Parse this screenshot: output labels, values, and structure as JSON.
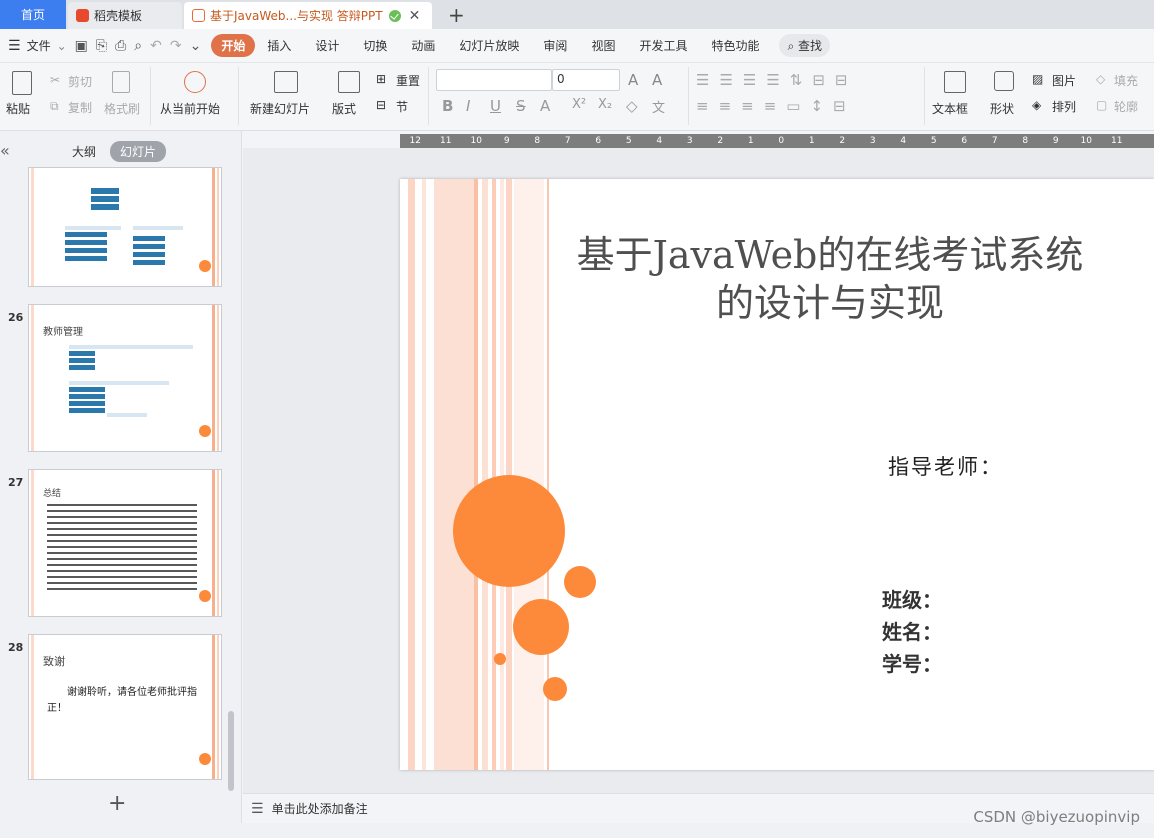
{
  "tabs": {
    "home": "首页",
    "tab1": "稻壳模板",
    "tab2": "基于JavaWeb...与实现 答辩PPT",
    "add": "+"
  },
  "ribbon": {
    "file": "文件",
    "items": [
      "开始",
      "插入",
      "设计",
      "切换",
      "动画",
      "幻灯片放映",
      "审阅",
      "视图",
      "开发工具",
      "特色功能"
    ],
    "search": "查找"
  },
  "toolbar": {
    "paste": "粘贴",
    "cut": "剪切",
    "copy": "复制",
    "format_painter": "格式刷",
    "from_current": "从当前开始",
    "new_slide": "新建幻灯片",
    "layout": "版式",
    "reset": "重置",
    "section": "节",
    "font_size": "0",
    "textbox": "文本框",
    "shape": "形状",
    "picture": "图片",
    "arrange": "排列",
    "fill": "填充",
    "outline": "轮廓"
  },
  "panel": {
    "collapse": "«",
    "outline_tab": "大纲",
    "slides_tab": "幻灯片",
    "thumbs": [
      {
        "num": "",
        "title": ""
      },
      {
        "num": "26",
        "title": "教师管理"
      },
      {
        "num": "27",
        "title": "总结"
      },
      {
        "num": "28",
        "title": "致谢",
        "body": "谢谢聆听，请各位老师批评指正！"
      }
    ],
    "add": "+"
  },
  "ruler": [
    "12",
    "11",
    "10",
    "9",
    "8",
    "7",
    "6",
    "5",
    "4",
    "3",
    "2",
    "1",
    "0",
    "1",
    "2",
    "3",
    "4",
    "5",
    "6",
    "7",
    "8",
    "9",
    "10",
    "11"
  ],
  "slide": {
    "title_line1": "基于JavaWeb的在线考试系统",
    "title_line2": "的设计与实现",
    "advisor": "指导老师：",
    "class": "班级：",
    "name": "姓名：",
    "id": "学号："
  },
  "notes": {
    "placeholder": "单击此处添加备注"
  },
  "watermark": "CSDN @biyezuopinvip",
  "colors": {
    "accent": "#e0724a",
    "circle": "#fd8a3a",
    "stripe": "#fcd9c9"
  }
}
